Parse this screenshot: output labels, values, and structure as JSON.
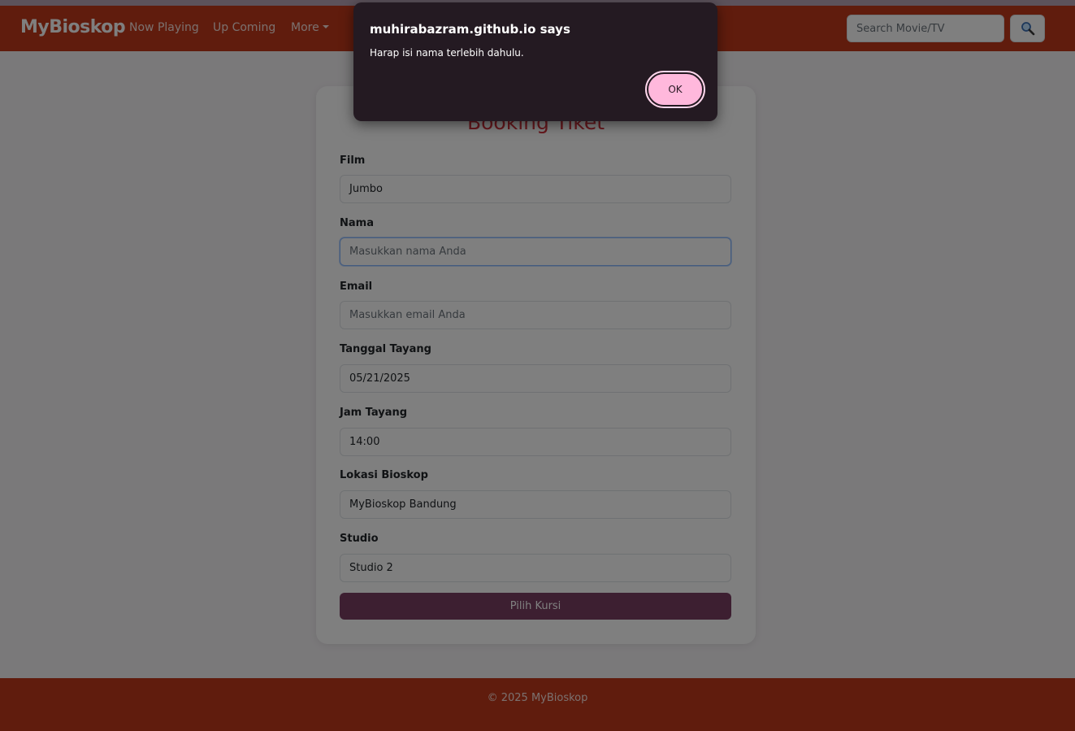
{
  "navbar": {
    "brand": "MyBioskop",
    "links": [
      "Now Playing",
      "Up Coming",
      "More"
    ],
    "search_placeholder": "Search Movie/TV",
    "search_icon": "magnifier-icon"
  },
  "form": {
    "title": "Booking Tiket",
    "fields": [
      {
        "label": "Film",
        "value": "Jumbo",
        "placeholder": ""
      },
      {
        "label": "Nama",
        "value": "",
        "placeholder": "Masukkan nama Anda"
      },
      {
        "label": "Email",
        "value": "",
        "placeholder": "Masukkan email Anda"
      },
      {
        "label": "Tanggal Tayang",
        "value": "05/21/2025",
        "placeholder": ""
      },
      {
        "label": "Jam Tayang",
        "value": "14:00",
        "placeholder": ""
      },
      {
        "label": "Lokasi Bioskop",
        "value": "MyBioskop Bandung",
        "placeholder": ""
      },
      {
        "label": "Studio",
        "value": "Studio 2",
        "placeholder": ""
      }
    ],
    "submit_label": "Pilih Kursi"
  },
  "footer": {
    "text": "© 2025 MyBioskop"
  },
  "dialog": {
    "title": "muhirabazram.github.io says",
    "message": "Harap isi nama terlebih dahulu.",
    "ok_label": "OK"
  },
  "colors": {
    "brand": "#c0391b",
    "accent_title": "#d0303b",
    "button": "#7b3f63",
    "dialog_bg": "#241a22",
    "dialog_button": "#ffb8dc"
  }
}
